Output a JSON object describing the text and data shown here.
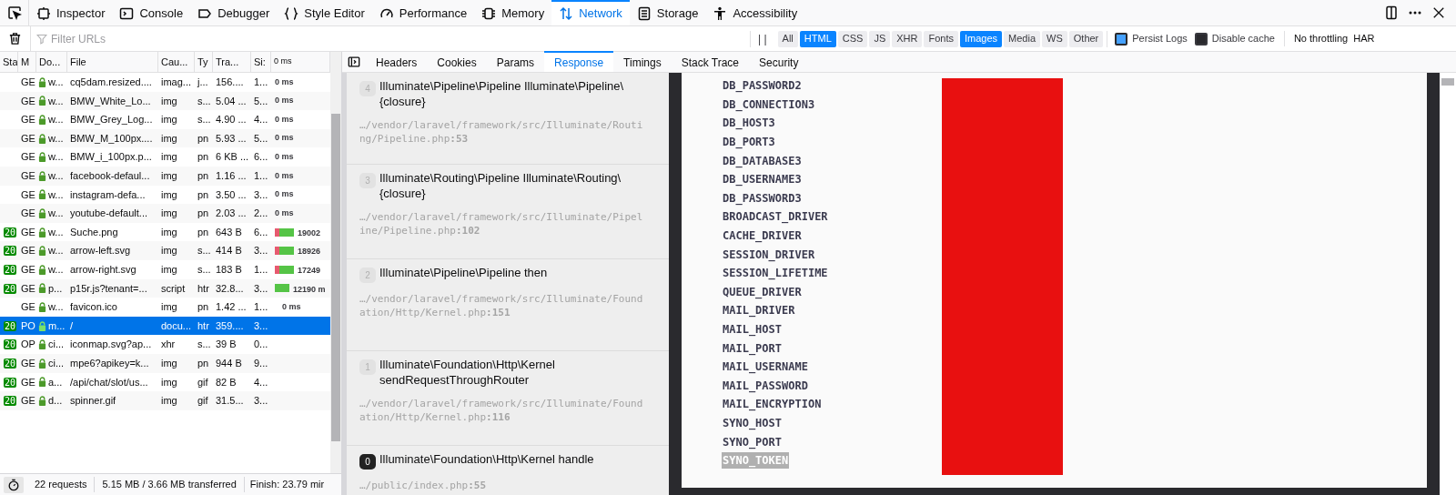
{
  "toolbar": {
    "tools": [
      {
        "label": "Inspector",
        "selected": false
      },
      {
        "label": "Console",
        "selected": false
      },
      {
        "label": "Debugger",
        "selected": false
      },
      {
        "label": "Style Editor",
        "selected": false
      },
      {
        "label": "Performance",
        "selected": false
      },
      {
        "label": "Memory",
        "selected": false
      },
      {
        "label": "Network",
        "selected": true
      },
      {
        "label": "Storage",
        "selected": false
      },
      {
        "label": "Accessibility",
        "selected": false
      }
    ]
  },
  "filter_bar": {
    "placeholder": "Filter URLs",
    "pause": "| |",
    "types": [
      {
        "label": "All",
        "selected": false
      },
      {
        "label": "HTML",
        "selected": true
      },
      {
        "label": "CSS",
        "selected": false
      },
      {
        "label": "JS",
        "selected": false
      },
      {
        "label": "XHR",
        "selected": false
      },
      {
        "label": "Fonts",
        "selected": false
      },
      {
        "label": "Images",
        "selected": true
      },
      {
        "label": "Media",
        "selected": false
      },
      {
        "label": "WS",
        "selected": false
      },
      {
        "label": "Other",
        "selected": false
      }
    ],
    "options": [
      {
        "label": "Persist Logs",
        "checked": true
      },
      {
        "label": "Disable cache",
        "checked": false
      }
    ],
    "throttling": "No throttling",
    "har": "HAR"
  },
  "table": {
    "columns": [
      "Sta",
      "M",
      "Do...",
      "File",
      "Cau...",
      "Ty",
      "Tra...",
      "Si:",
      "0 ms"
    ],
    "rows": [
      {
        "method": "GE",
        "domain": "w...",
        "file": "cq5dam.resized....",
        "cause": "imag...",
        "type": "j...",
        "transferred": "156....",
        "size": "1...",
        "timing": {
          "kind": "text",
          "label": "0 ms"
        },
        "selected": false
      },
      {
        "method": "GE",
        "domain": "w...",
        "file": "BMW_White_Lo...",
        "cause": "img",
        "type": "s...",
        "transferred": "5.04 ...",
        "size": "5...",
        "timing": {
          "kind": "text",
          "label": "0 ms"
        },
        "selected": false
      },
      {
        "method": "GE",
        "domain": "w...",
        "file": "BMW_Grey_Log...",
        "cause": "img",
        "type": "s...",
        "transferred": "4.90 ...",
        "size": "4...",
        "timing": {
          "kind": "text",
          "label": "0 ms"
        },
        "selected": false
      },
      {
        "method": "GE",
        "domain": "w...",
        "file": "BMW_M_100px....",
        "cause": "img",
        "type": "pn",
        "transferred": "5.93 ...",
        "size": "5...",
        "timing": {
          "kind": "text",
          "label": "0 ms"
        },
        "selected": false
      },
      {
        "method": "GE",
        "domain": "w...",
        "file": "BMW_i_100px.p...",
        "cause": "img",
        "type": "pn",
        "transferred": "6 KB ...",
        "size": "6...",
        "timing": {
          "kind": "text",
          "label": "0 ms"
        },
        "selected": false
      },
      {
        "method": "GE",
        "domain": "w...",
        "file": "facebook-defaul...",
        "cause": "img",
        "type": "pn",
        "transferred": "1.16 ...",
        "size": "1...",
        "timing": {
          "kind": "text",
          "label": "0 ms"
        },
        "selected": false
      },
      {
        "method": "GE",
        "domain": "w...",
        "file": "instagram-defa...",
        "cause": "img",
        "type": "pn",
        "transferred": "3.50 ...",
        "size": "3...",
        "timing": {
          "kind": "text",
          "label": "0 ms"
        },
        "selected": false
      },
      {
        "method": "GE",
        "domain": "w...",
        "file": "youtube-default...",
        "cause": "img",
        "type": "pn",
        "transferred": "2.03 ...",
        "size": "2...",
        "timing": {
          "kind": "text",
          "label": "0 ms"
        },
        "selected": false
      },
      {
        "status": "20",
        "method": "GE",
        "domain": "w...",
        "file": "Suche.png",
        "cause": "img",
        "type": "pn",
        "transferred": "643 B",
        "size": "6...",
        "timing": {
          "kind": "bar",
          "blocked": true,
          "label": "19002"
        },
        "selected": false
      },
      {
        "status": "20",
        "method": "GE",
        "domain": "w...",
        "file": "arrow-left.svg",
        "cause": "img",
        "type": "s...",
        "transferred": "414 B",
        "size": "3...",
        "timing": {
          "kind": "bar",
          "blocked": true,
          "label": "18926"
        },
        "selected": false
      },
      {
        "status": "20",
        "method": "GE",
        "domain": "w...",
        "file": "arrow-right.svg",
        "cause": "img",
        "type": "s...",
        "transferred": "183 B",
        "size": "1...",
        "timing": {
          "kind": "bar",
          "blocked": true,
          "label": "17249"
        },
        "selected": false
      },
      {
        "status": "20",
        "method": "GE",
        "domain": "p...",
        "file": "p15r.js?tenant=...",
        "cause": "script",
        "type": "htr",
        "transferred": "32.8...",
        "size": "3...",
        "timing": {
          "kind": "bar",
          "blocked": false,
          "label": "12190 m"
        },
        "selected": false
      },
      {
        "method": "GE",
        "domain": "w...",
        "file": "favicon.ico",
        "cause": "img",
        "type": "pn",
        "transferred": "1.42 ...",
        "size": "1...",
        "timing": {
          "kind": "text",
          "label": "0 ms"
        },
        "selected": false
      },
      {
        "status": "20",
        "method": "PO",
        "domain": "m...",
        "file": "/",
        "cause": "docu...",
        "type": "htr",
        "transferred": "359....",
        "size": "3...",
        "selected": true
      },
      {
        "status": "20",
        "method": "OP",
        "domain": "ci...",
        "file": "iconmap.svg?ap...",
        "cause": "xhr",
        "type": "s...",
        "transferred": "39 B",
        "size": "0...",
        "selected": false
      },
      {
        "status": "20",
        "method": "GE",
        "domain": "ci...",
        "file": "mpe6?apikey=k...",
        "cause": "img",
        "type": "pn",
        "transferred": "944 B",
        "size": "9...",
        "selected": false
      },
      {
        "status": "20",
        "method": "GE",
        "domain": "a...",
        "file": "/api/chat/slot/us...",
        "cause": "img",
        "type": "gif",
        "transferred": "82 B",
        "size": "4...",
        "selected": false
      },
      {
        "status": "20",
        "method": "GE",
        "domain": "d...",
        "file": "spinner.gif",
        "cause": "img",
        "type": "gif",
        "transferred": "31.5...",
        "size": "3...",
        "selected": false
      }
    ]
  },
  "status_bar": {
    "requests": "22 requests",
    "transferred": "5.15 MB / 3.66 MB transferred",
    "finish": "Finish: 23.79 mir"
  },
  "detail_tabs": [
    {
      "label": "Headers",
      "selected": false
    },
    {
      "label": "Cookies",
      "selected": false
    },
    {
      "label": "Params",
      "selected": false
    },
    {
      "label": "Response",
      "selected": true
    },
    {
      "label": "Timings",
      "selected": false
    },
    {
      "label": "Stack Trace",
      "selected": false
    },
    {
      "label": "Security",
      "selected": false
    }
  ],
  "stack_frames": [
    {
      "index": "4",
      "title": "Illuminate\\Pipeline\\Pipeline Illuminate\\Pipeline\\{closure}",
      "path": "…/vendor/laravel/framework/src/Illuminate/Routing/Pipeline.php",
      "line": ":53",
      "active": false
    },
    {
      "index": "3",
      "title": "Illuminate\\Routing\\Pipeline Illuminate\\Routing\\{closure}",
      "path": "…/vendor/laravel/framework/src/Illuminate/Pipeline/Pipeline.php",
      "line": ":102",
      "active": false
    },
    {
      "index": "2",
      "title": "Illuminate\\Pipeline\\Pipeline then",
      "path": "…/vendor/laravel/framework/src/Illuminate/Foundation/Http/Kernel.php",
      "line": ":151",
      "active": false
    },
    {
      "index": "1",
      "title": "Illuminate\\Foundation\\Http\\Kernel sendRequestThroughRouter",
      "path": "…/vendor/laravel/framework/src/Illuminate/Foundation/Http/Kernel.php",
      "line": ":116",
      "active": false
    },
    {
      "index": "0",
      "title": "Illuminate\\Foundation\\Http\\Kernel handle",
      "path": "…/public/index.php",
      "line": ":55",
      "active": true
    }
  ],
  "env_keys": [
    {
      "name": "DB_PASSWORD2",
      "highlighted": false
    },
    {
      "name": "DB_CONNECTION3",
      "highlighted": false
    },
    {
      "name": "DB_HOST3",
      "highlighted": false
    },
    {
      "name": "DB_PORT3",
      "highlighted": false
    },
    {
      "name": "DB_DATABASE3",
      "highlighted": false
    },
    {
      "name": "DB_USERNAME3",
      "highlighted": false
    },
    {
      "name": "DB_PASSWORD3",
      "highlighted": false
    },
    {
      "name": "BROADCAST_DRIVER",
      "highlighted": false
    },
    {
      "name": "CACHE_DRIVER",
      "highlighted": false
    },
    {
      "name": "SESSION_DRIVER",
      "highlighted": false
    },
    {
      "name": "SESSION_LIFETIME",
      "highlighted": false
    },
    {
      "name": "QUEUE_DRIVER",
      "highlighted": false
    },
    {
      "name": "MAIL_DRIVER",
      "highlighted": false
    },
    {
      "name": "MAIL_HOST",
      "highlighted": false
    },
    {
      "name": "MAIL_PORT",
      "highlighted": false
    },
    {
      "name": "MAIL_USERNAME",
      "highlighted": false
    },
    {
      "name": "MAIL_PASSWORD",
      "highlighted": false
    },
    {
      "name": "MAIL_ENCRYPTION",
      "highlighted": false
    },
    {
      "name": "SYNO_HOST",
      "highlighted": false
    },
    {
      "name": "SYNO_PORT",
      "highlighted": false
    },
    {
      "name": "SYNO_TOKEN",
      "highlighted": true
    }
  ]
}
